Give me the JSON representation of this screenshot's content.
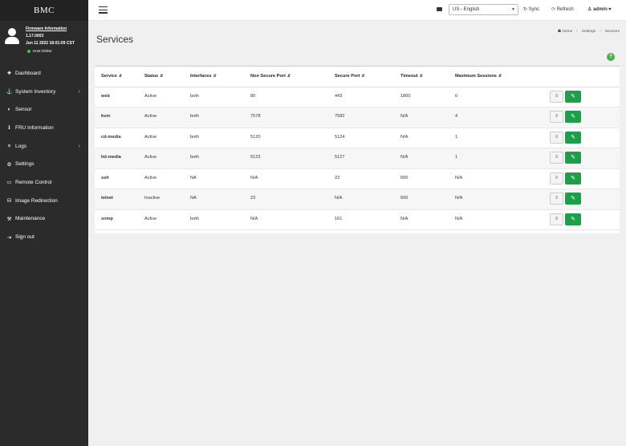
{
  "sidebar": {
    "brand": "BMC",
    "firmware_link": "Firmware Information",
    "firmware_version": "1.17.0003",
    "firmware_date": "Jun 11 2022 18:01:09 CST",
    "host_status": "Host Online",
    "items": [
      {
        "label": "Dashboard",
        "icon": "dashboard-icon",
        "glyph": "❖",
        "chevron": false
      },
      {
        "label": "System Inventory",
        "icon": "inventory-icon",
        "glyph": "⚓",
        "chevron": true
      },
      {
        "label": "Sensor",
        "icon": "sensor-icon",
        "glyph": "◐",
        "chevron": false
      },
      {
        "label": "FRU Information",
        "icon": "info-icon",
        "glyph": "ℹ",
        "chevron": false
      },
      {
        "label": "Logs",
        "icon": "chart-icon",
        "glyph": "≡",
        "chevron": true
      },
      {
        "label": "Settings",
        "icon": "gear-icon",
        "glyph": "⚙",
        "chevron": false
      },
      {
        "label": "Remote Control",
        "icon": "monitor-icon",
        "glyph": "▭",
        "chevron": false
      },
      {
        "label": "Image Redirection",
        "icon": "drive-icon",
        "glyph": "⛁",
        "chevron": false
      },
      {
        "label": "Maintenance",
        "icon": "wrench-icon",
        "glyph": "⚒",
        "chevron": false
      },
      {
        "label": "Sign out",
        "icon": "sign-out-icon",
        "glyph": "⇥",
        "chevron": false
      }
    ]
  },
  "topbar": {
    "language": "US - English",
    "sync_label": "Sync",
    "refresh_label": "Refresh",
    "user": "admin"
  },
  "page": {
    "title": "Services",
    "breadcrumb": [
      "Home",
      "Settings",
      "Services"
    ]
  },
  "table": {
    "headers": [
      "Service",
      "Status",
      "Interfaces",
      "Non Secure Port",
      "Secure Port",
      "Timeout",
      "Maximum Sessions"
    ],
    "rows": [
      [
        "web",
        "Active",
        "both",
        "80",
        "443",
        "1800",
        "6"
      ],
      [
        "kvm",
        "Active",
        "both",
        "7578",
        "7582",
        "N/A",
        "4"
      ],
      [
        "cd-media",
        "Active",
        "both",
        "5120",
        "5124",
        "N/A",
        "1"
      ],
      [
        "hd-media",
        "Active",
        "both",
        "5123",
        "5127",
        "N/A",
        "1"
      ],
      [
        "ssh",
        "Active",
        "NA",
        "N/A",
        "22",
        "600",
        "N/A"
      ],
      [
        "telnet",
        "Inactive",
        "NA",
        "23",
        "N/A",
        "600",
        "N/A"
      ],
      [
        "snmp",
        "Active",
        "both",
        "N/A",
        "161",
        "N/A",
        "N/A"
      ]
    ]
  },
  "colors": {
    "sidebar_bg": "#2b2b2b",
    "edit_button": "#1e9e4a",
    "host_online": "#2ecc40",
    "help": "#4cae4c",
    "refresh_icon": "#2a7fd4"
  }
}
